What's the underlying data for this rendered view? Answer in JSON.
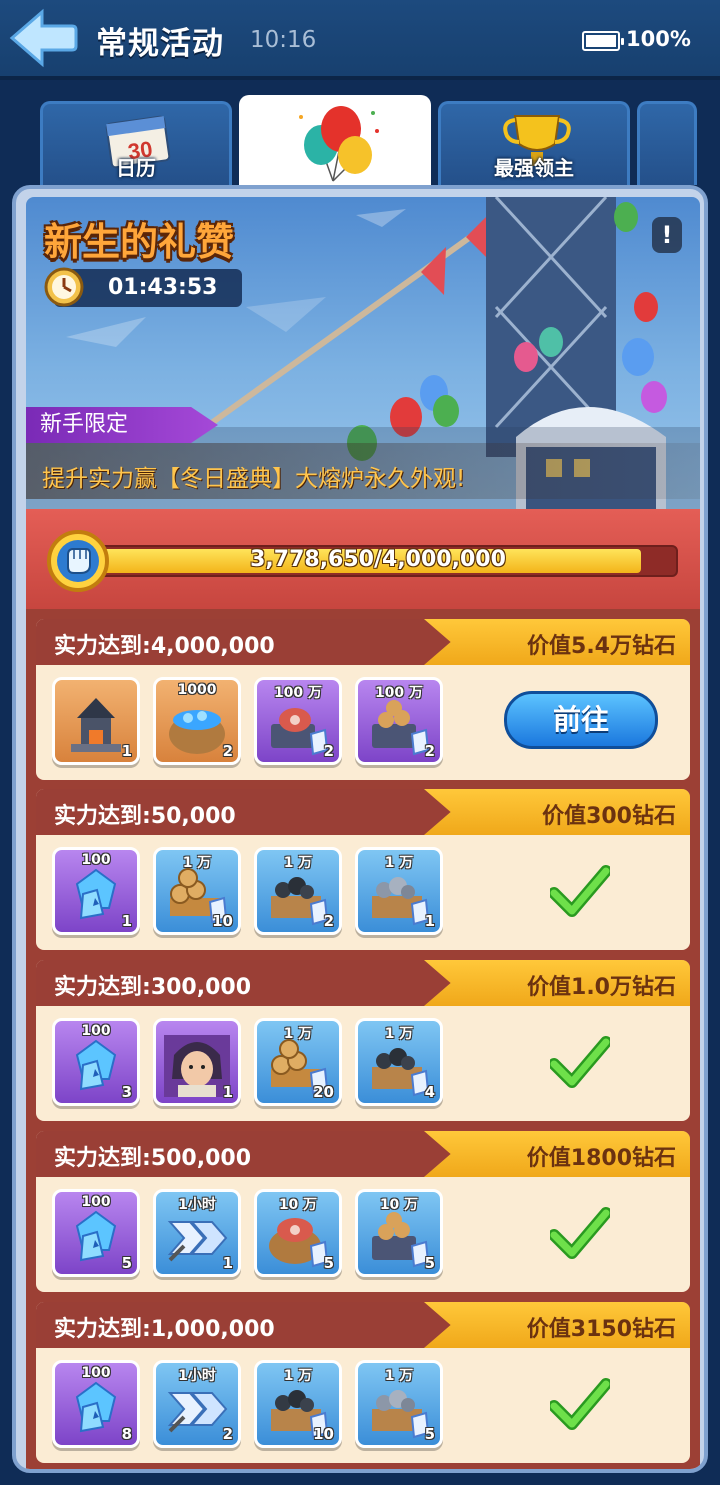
{
  "header": {
    "title": "常规活动",
    "time": "10:16",
    "battery": "100%"
  },
  "tabs": [
    {
      "label": "日历",
      "calendar_number": "30"
    },
    {
      "label": ""
    },
    {
      "label": "最强领主"
    }
  ],
  "event": {
    "title": "新生的礼赞",
    "timer": "01:43:53",
    "tag": "新手限定",
    "subtitle": "提升实力赢【冬日盛典】大熔炉永久外观!",
    "info_icon": "!"
  },
  "progress": {
    "text": "3,778,650/4,000,000",
    "current": 3778650,
    "max": 4000000
  },
  "tiers": [
    {
      "label": "实力达到:",
      "threshold": "4,000,000",
      "value": "价值5.4万钻石",
      "action": "前往",
      "completed": false,
      "rewards": [
        {
          "icon": "furnace-icon",
          "amount": "",
          "count": "1",
          "rarity": "orange"
        },
        {
          "icon": "gem-sack-icon",
          "amount": "1000",
          "count": "2",
          "rarity": "orange"
        },
        {
          "icon": "meat-crate-icon",
          "amount": "100 万",
          "count": "2",
          "rarity": "purple"
        },
        {
          "icon": "wood-crate-icon",
          "amount": "100 万",
          "count": "2",
          "rarity": "purple"
        }
      ]
    },
    {
      "label": "实力达到:",
      "threshold": "50,000",
      "value": "价值300钻石",
      "completed": true,
      "rewards": [
        {
          "icon": "gem-pile-icon",
          "amount": "100",
          "count": "1",
          "rarity": "purple"
        },
        {
          "icon": "wood-pile-icon",
          "amount": "1 万",
          "count": "10",
          "rarity": "blue"
        },
        {
          "icon": "coal-crate-icon",
          "amount": "1 万",
          "count": "2",
          "rarity": "blue"
        },
        {
          "icon": "iron-crate-icon",
          "amount": "1 万",
          "count": "1",
          "rarity": "blue"
        }
      ]
    },
    {
      "label": "实力达到:",
      "threshold": "300,000",
      "value": "价值1.0万钻石",
      "completed": true,
      "rewards": [
        {
          "icon": "gem-pile-icon",
          "amount": "100",
          "count": "3",
          "rarity": "purple"
        },
        {
          "icon": "hero-portrait-icon",
          "amount": "",
          "count": "1",
          "rarity": "purple"
        },
        {
          "icon": "wood-pile-icon",
          "amount": "1 万",
          "count": "20",
          "rarity": "blue"
        },
        {
          "icon": "coal-crate-icon",
          "amount": "1 万",
          "count": "4",
          "rarity": "blue"
        }
      ]
    },
    {
      "label": "实力达到:",
      "threshold": "500,000",
      "value": "价值1800钻石",
      "completed": true,
      "rewards": [
        {
          "icon": "gem-pile-icon",
          "amount": "100",
          "count": "5",
          "rarity": "purple"
        },
        {
          "icon": "speedup-icon",
          "amount": "1小时",
          "count": "1",
          "rarity": "blue"
        },
        {
          "icon": "meat-sack-icon",
          "amount": "10 万",
          "count": "5",
          "rarity": "blue"
        },
        {
          "icon": "wood-crate-icon",
          "amount": "10 万",
          "count": "5",
          "rarity": "blue"
        }
      ]
    },
    {
      "label": "实力达到:",
      "threshold": "1,000,000",
      "value": "价值3150钻石",
      "completed": true,
      "rewards": [
        {
          "icon": "gem-pile-icon",
          "amount": "100",
          "count": "8",
          "rarity": "purple"
        },
        {
          "icon": "speedup-icon",
          "amount": "1小时",
          "count": "2",
          "rarity": "blue"
        },
        {
          "icon": "coal-crate-icon",
          "amount": "1 万",
          "count": "10",
          "rarity": "blue"
        },
        {
          "icon": "iron-crate-icon",
          "amount": "1 万",
          "count": "5",
          "rarity": "blue"
        }
      ]
    }
  ]
}
